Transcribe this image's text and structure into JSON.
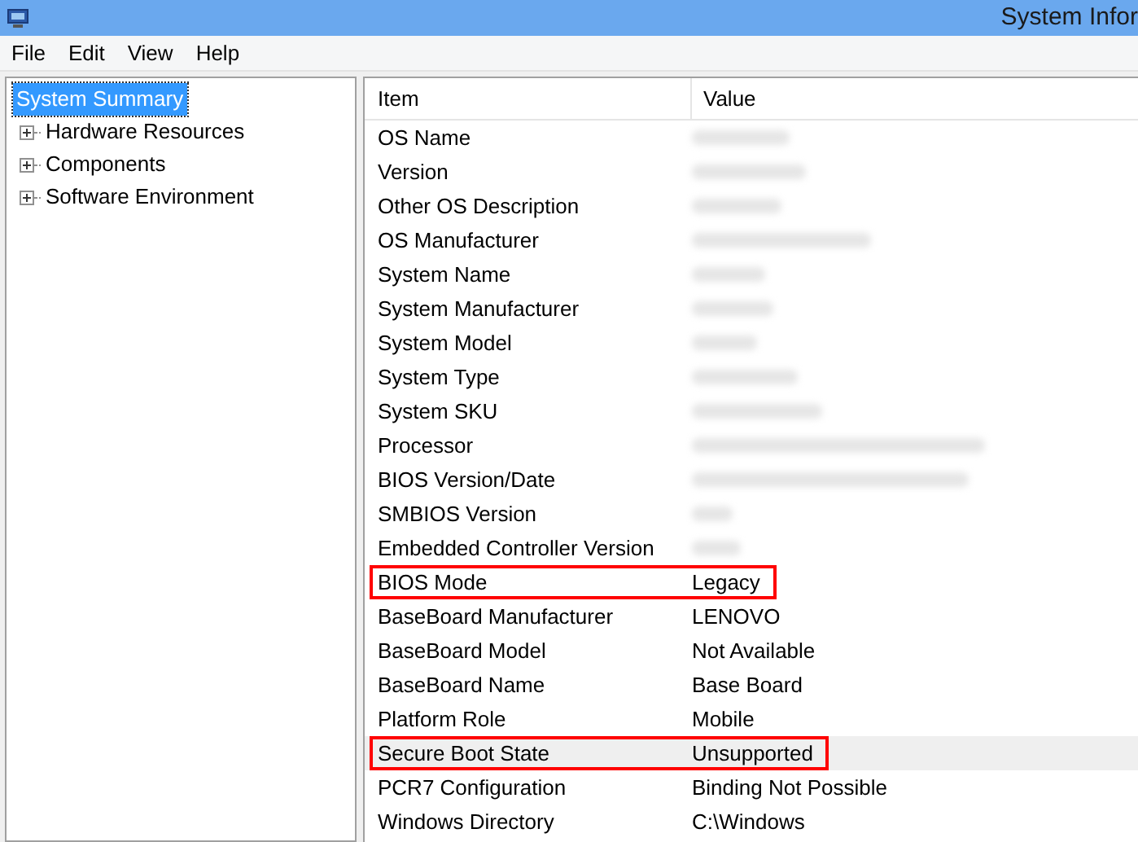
{
  "window": {
    "title": "System Infor"
  },
  "menu": [
    "File",
    "Edit",
    "View",
    "Help"
  ],
  "tree": [
    {
      "label": "System Summary",
      "selected": true,
      "expandable": false
    },
    {
      "label": "Hardware Resources",
      "selected": false,
      "expandable": true
    },
    {
      "label": "Components",
      "selected": false,
      "expandable": true
    },
    {
      "label": "Software Environment",
      "selected": false,
      "expandable": true
    }
  ],
  "table": {
    "columns": [
      "Item",
      "Value"
    ],
    "rows": [
      {
        "item": "OS Name",
        "redacted": true,
        "selected": false,
        "highlighted": false
      },
      {
        "item": "Version",
        "redacted": true,
        "selected": false,
        "highlighted": false
      },
      {
        "item": "Other OS Description",
        "redacted": true,
        "selected": false,
        "highlighted": false
      },
      {
        "item": "OS Manufacturer",
        "redacted": true,
        "selected": false,
        "highlighted": false
      },
      {
        "item": "System Name",
        "redacted": true,
        "selected": false,
        "highlighted": false
      },
      {
        "item": "System Manufacturer",
        "redacted": true,
        "selected": false,
        "highlighted": false
      },
      {
        "item": "System Model",
        "redacted": true,
        "selected": false,
        "highlighted": false
      },
      {
        "item": "System Type",
        "redacted": true,
        "selected": false,
        "highlighted": false
      },
      {
        "item": "System SKU",
        "redacted": true,
        "selected": false,
        "highlighted": false
      },
      {
        "item": "Processor",
        "redacted": true,
        "selected": false,
        "highlighted": false
      },
      {
        "item": "BIOS Version/Date",
        "redacted": true,
        "selected": false,
        "highlighted": false
      },
      {
        "item": "SMBIOS Version",
        "redacted": true,
        "selected": false,
        "highlighted": false
      },
      {
        "item": "Embedded Controller Version",
        "redacted": true,
        "selected": false,
        "highlighted": false
      },
      {
        "item": "BIOS Mode",
        "value": "Legacy",
        "redacted": false,
        "selected": false,
        "highlighted": true
      },
      {
        "item": "BaseBoard Manufacturer",
        "value": "LENOVO",
        "redacted": false,
        "selected": false,
        "highlighted": false
      },
      {
        "item": "BaseBoard Model",
        "value": "Not Available",
        "redacted": false,
        "selected": false,
        "highlighted": false
      },
      {
        "item": "BaseBoard Name",
        "value": "Base Board",
        "redacted": false,
        "selected": false,
        "highlighted": false
      },
      {
        "item": "Platform Role",
        "value": "Mobile",
        "redacted": false,
        "selected": false,
        "highlighted": false
      },
      {
        "item": "Secure Boot State",
        "value": "Unsupported",
        "redacted": false,
        "selected": true,
        "highlighted": true
      },
      {
        "item": "PCR7 Configuration",
        "value": "Binding Not Possible",
        "redacted": false,
        "selected": false,
        "highlighted": false
      },
      {
        "item": "Windows Directory",
        "value": "C:\\Windows",
        "redacted": false,
        "selected": false,
        "highlighted": false
      }
    ]
  }
}
